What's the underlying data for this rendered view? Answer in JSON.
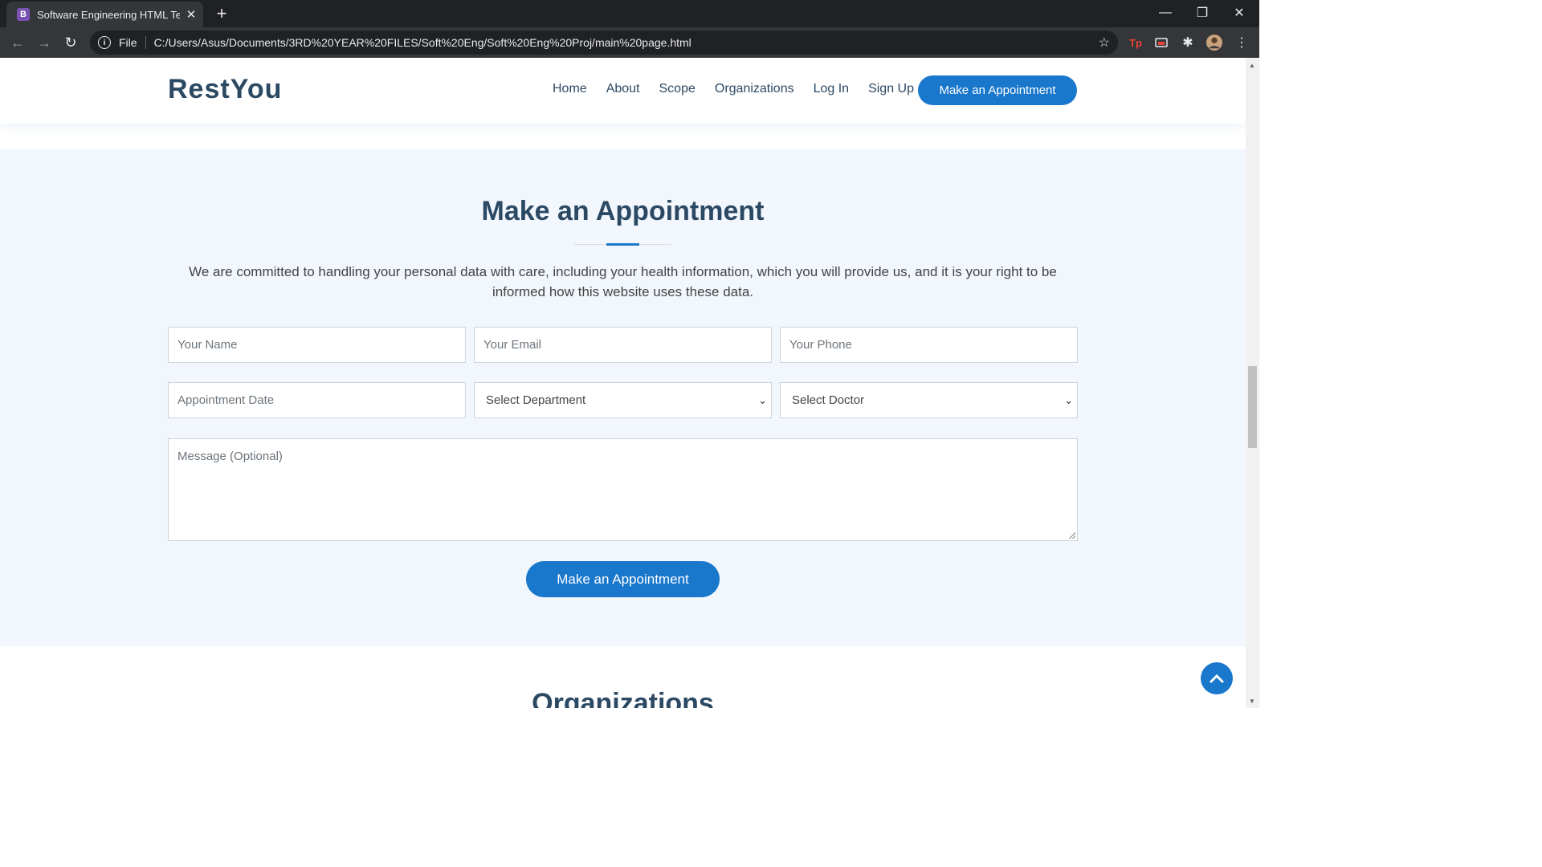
{
  "browser": {
    "tab_title": "Software Engineering HTML Tem",
    "favicon_letter": "B",
    "scheme_label": "File",
    "url": "C:/Users/Asus/Documents/3RD%20YEAR%20FILES/Soft%20Eng/Soft%20Eng%20Proj/main%20page.html",
    "ext_label": "Tp"
  },
  "header": {
    "logo": "RestYou",
    "nav": [
      "Home",
      "About",
      "Scope",
      "Organizations",
      "Log In",
      "Sign Up"
    ],
    "cta": "Make an Appointment"
  },
  "appointment": {
    "title": "Make an Appointment",
    "description": "We are committed to handling your personal data with care, including your health information, which you will provide us, and it is your right to be informed how this website uses these data.",
    "fields": {
      "name_placeholder": "Your Name",
      "email_placeholder": "Your Email",
      "phone_placeholder": "Your Phone",
      "date_placeholder": "Appointment Date",
      "department_selected": "Select Department",
      "doctor_selected": "Select Doctor",
      "message_placeholder": "Message (Optional)"
    },
    "submit": "Make an Appointment"
  },
  "next_section": {
    "title": "Organizations"
  },
  "colors": {
    "accent": "#1977cc",
    "heading": "#2c4964",
    "section_bg": "#f1f7fd"
  }
}
